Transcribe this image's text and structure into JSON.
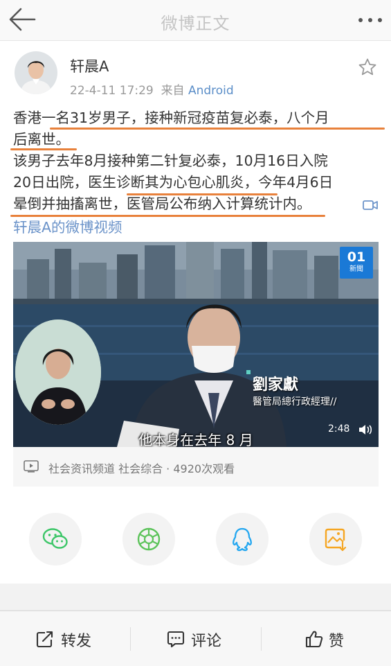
{
  "nav": {
    "title": "微博正文"
  },
  "post": {
    "author": "轩晨A",
    "time": "22-4-11 17:29",
    "source_prefix": "来自",
    "source": "Android",
    "text_lines": [
      "香港一名31岁男子，接种新冠疫苗复必泰，八个月",
      "后离世。",
      "该男子去年8月接种第二针复必泰，10月16日入院",
      "20日出院，医生诊断其为心包心肌炎，今年4月6日",
      "晕倒并抽搐离世，医管局公布纳入计算统计内。"
    ],
    "video_link": "轩晨A的微博视频",
    "highlight_color": "#e8813b",
    "link_color": "#6b93c9"
  },
  "video": {
    "channel_logo_main": "01",
    "channel_logo_sub": "新聞",
    "speaker_name": "劉家獻",
    "speaker_title": "醫管局總行政經理//",
    "subtitle": "他本身在去年 8 月",
    "duration": "2:48",
    "info": "社会资讯频道 社会综合 · 4920次观看"
  },
  "share": {
    "items": [
      {
        "icon": "wechat-icon",
        "color": "#3cc668"
      },
      {
        "icon": "moments-icon",
        "color": "#5cc35a"
      },
      {
        "icon": "qq-icon",
        "color": "#24a7f0"
      },
      {
        "icon": "save-image-icon",
        "color": "#f5a623"
      }
    ]
  },
  "actions": {
    "repost": "转发",
    "comment": "评论",
    "like": "赞"
  }
}
